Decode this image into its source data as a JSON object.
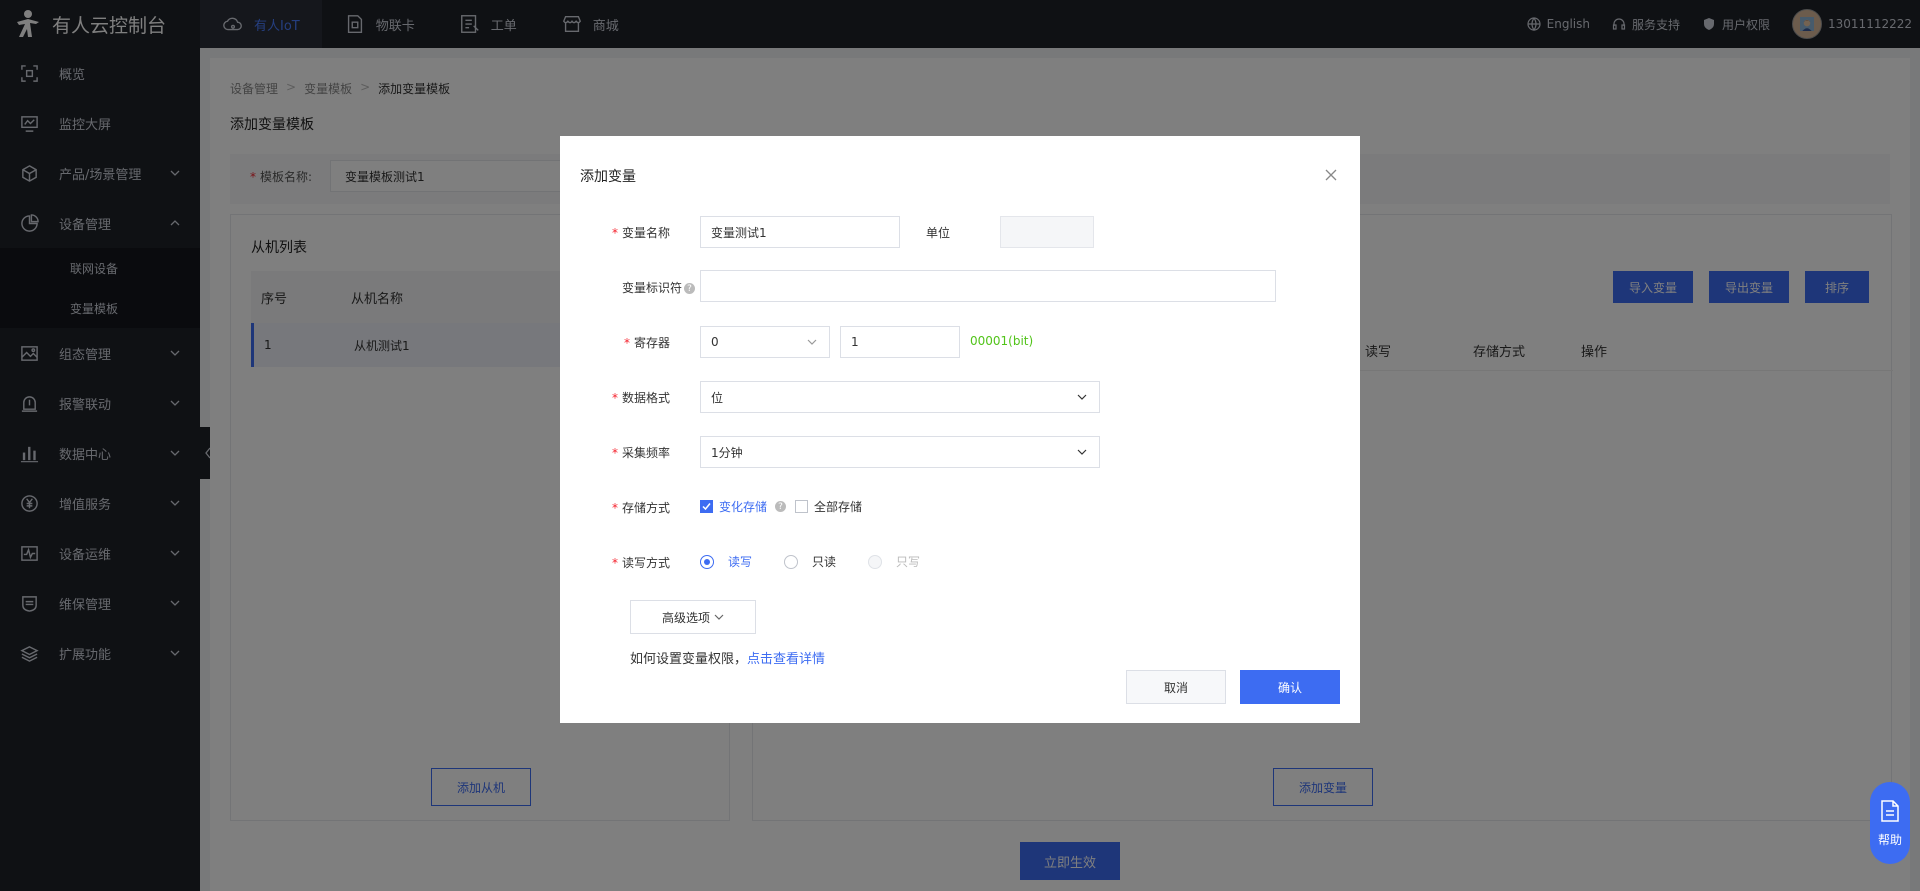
{
  "app": {
    "title": "有人云控制台"
  },
  "topnav": [
    {
      "label": "有人IoT",
      "icon": "cloud-icon"
    },
    {
      "label": "物联卡",
      "icon": "sim-card-icon"
    },
    {
      "label": "工单",
      "icon": "ticket-icon"
    },
    {
      "label": "商城",
      "icon": "store-icon"
    }
  ],
  "topright": {
    "language": "English",
    "support": "服务支持",
    "permissions": "用户权限",
    "username": "13011112222"
  },
  "sidebar": {
    "items": [
      {
        "label": "概览"
      },
      {
        "label": "监控大屏"
      },
      {
        "label": "产品/场景管理"
      },
      {
        "label": "设备管理"
      },
      {
        "label": "组态管理"
      },
      {
        "label": "报警联动"
      },
      {
        "label": "数据中心"
      },
      {
        "label": "增值服务"
      },
      {
        "label": "设备运维"
      },
      {
        "label": "维保管理"
      },
      {
        "label": "扩展功能"
      }
    ],
    "sub": [
      "联网设备",
      "变量模板"
    ]
  },
  "breadcrumb": [
    "设备管理",
    "变量模板",
    "添加变量模板"
  ],
  "page_title": "添加变量模板",
  "template": {
    "label": "模板名称:",
    "value": "变量模板测试1"
  },
  "slave_panel": {
    "title": "从机列表",
    "columns": [
      "序号",
      "从机名称"
    ],
    "rows": [
      {
        "index": "1",
        "name": "从机测试1"
      }
    ],
    "add_button": "添加从机"
  },
  "var_panel": {
    "buttons": [
      "导入变量",
      "导出变量",
      "排序"
    ],
    "columns": [
      "读写",
      "存储方式",
      "操作"
    ],
    "add_button": "添加变量"
  },
  "submit_button": "立即生效",
  "modal": {
    "title": "添加变量",
    "name_label": "变量名称",
    "name_value": "变量测试1",
    "unit_label": "单位",
    "identifier_label": "变量标识符",
    "register_label": "寄存器",
    "register_type": "0",
    "register_addr": "1",
    "register_hint": "00001(bit)",
    "format_label": "数据格式",
    "format_value": "位",
    "freq_label": "采集频率",
    "freq_value": "1分钟",
    "storage_label": "存储方式",
    "storage_change": "变化存储",
    "storage_all": "全部存储",
    "rw_label": "读写方式",
    "rw_options": [
      "读写",
      "只读",
      "只写"
    ],
    "advanced": "高级选项",
    "perm_tip": "如何设置变量权限，",
    "perm_link": "点击查看详情",
    "cancel": "取消",
    "confirm": "确认"
  },
  "help": "帮助",
  "colors": {
    "primary": "#3d6cf2",
    "sidebar": "#1f2229",
    "success": "#52c41a"
  }
}
